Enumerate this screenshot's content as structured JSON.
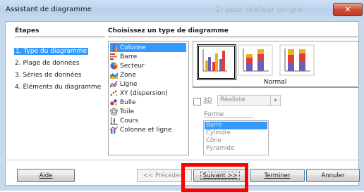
{
  "window": {
    "title": "Assistant de diagramme",
    "background_title_fragment": "2) pour réaliser un gra",
    "close_symbol": "✕"
  },
  "steps": {
    "title": "Étapes",
    "items": [
      {
        "label": "1. Type du diagramme",
        "selected": true
      },
      {
        "label": "2. Plage de données",
        "selected": false
      },
      {
        "label": "3. Séries de données",
        "selected": false
      },
      {
        "label": "4. Éléments du diagramme",
        "selected": false
      }
    ]
  },
  "chart_type": {
    "title": "Choisissez un type de diagramme",
    "types": [
      {
        "label": "Colonne",
        "icon": "column-chart-icon",
        "selected": true
      },
      {
        "label": "Barre",
        "icon": "bar-chart-icon"
      },
      {
        "label": "Secteur",
        "icon": "pie-chart-icon"
      },
      {
        "label": "Zone",
        "icon": "area-chart-icon"
      },
      {
        "label": "Ligne",
        "icon": "line-chart-icon"
      },
      {
        "label": "XY (dispersion)",
        "icon": "scatter-chart-icon"
      },
      {
        "label": "Bulle",
        "icon": "bubble-chart-icon"
      },
      {
        "label": "Toile",
        "icon": "net-chart-icon"
      },
      {
        "label": "Cours",
        "icon": "stock-chart-icon"
      },
      {
        "label": "Colonne et ligne",
        "icon": "column-line-chart-icon"
      }
    ],
    "variants": [
      {
        "icon": "normal-column-icon",
        "selected": true
      },
      {
        "icon": "stacked-column-icon"
      },
      {
        "icon": "percent-stacked-column-icon"
      }
    ],
    "variant_label": "Normal"
  },
  "three_d": {
    "checkbox_label": "3D",
    "checked": false,
    "style_value": "Réaliste"
  },
  "shape": {
    "label": "Forme",
    "options": [
      {
        "label": "Barre",
        "selected": true
      },
      {
        "label": "Cylindre"
      },
      {
        "label": "Cône"
      },
      {
        "label": "Pyramide"
      }
    ]
  },
  "buttons": {
    "help": "Aide",
    "back": "<< Précédent",
    "next": "Suivant >>",
    "finish": "Terminer",
    "cancel": "Annuler"
  },
  "colors": {
    "selection": "#3399ff",
    "highlight": "#ff0000",
    "bar_blue": "#6b5fb5",
    "bar_red": "#e03c3c",
    "bar_yellow": "#f0c020"
  }
}
